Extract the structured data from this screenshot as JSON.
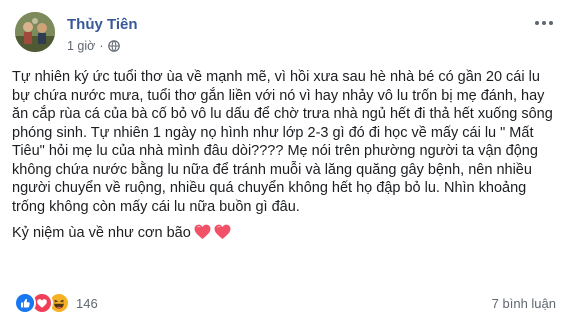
{
  "post": {
    "author": "Thủy Tiên",
    "timestamp": "1 giờ",
    "separator": "·",
    "privacy_icon": "globe-icon",
    "paragraph_1": "Tự nhiên ký ức tuổi thơ ùa về mạnh mẽ, vì hồi xưa sau hè nhà bé có gần 20 cái lu bự chứa nước mưa, tuổi thơ gắn liền với nó vì hay nhảy vô lu trốn bị mẹ đánh, hay ăn cắp rùa cá của bà cố bỏ vô lu dấu để chờ trưa nhà ngủ hết đi thả hết xuống sông phóng sinh. Tự nhiên 1 ngày nọ hình như lớp 2-3 gì đó đi học về mấy cái lu \" Mất Tiêu\" hỏi mẹ lu của nhà mình đâu dòi???? Mẹ nói trên phường người ta vận động không chứa nước bằng lu nữa để tránh muỗi và lăng quăng gây bệnh, nên nhiều người chuyển về ruộng, nhiều quá chuyển không hết họ đập bỏ lu. Nhìn khoảng trống không còn mấy cái lu nữa buồn gì đâu.",
    "paragraph_2": "Kỷ niệm ùa về như cơn bão",
    "emoji": [
      "heart-icon",
      "heart-icon"
    ]
  },
  "footer": {
    "reactions": [
      "like-icon",
      "love-icon",
      "haha-icon"
    ],
    "reaction_count": "146",
    "comments": "7 bình luận"
  },
  "colors": {
    "author": "#385898",
    "meta": "#606770",
    "text": "#1c1e21",
    "like": "#1877f2",
    "love": "#f33e58",
    "haha": "#f7b125"
  }
}
